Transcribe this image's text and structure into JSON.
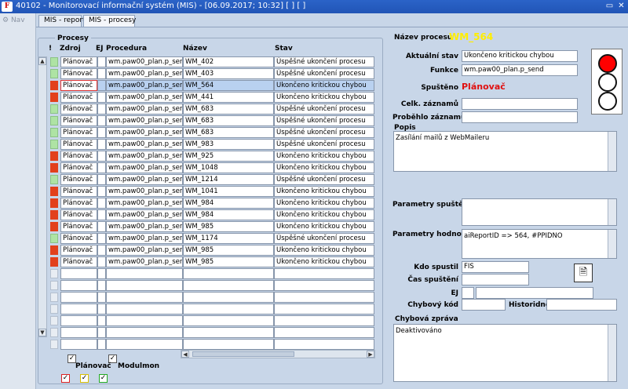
{
  "window": {
    "title": "40102 - Monitorovací informační systém (MIS) - [06.09.2017; 10:32]  [ ]  [ ]"
  },
  "nav": {
    "label": "Nav"
  },
  "tabs": [
    {
      "label": "MIS - reporty"
    },
    {
      "label": "MIS - procesy"
    }
  ],
  "grid": {
    "group_title": "Procesy",
    "headers": {
      "flag": "!",
      "zdroj": "Zdroj",
      "ej": "EJ",
      "procedura": "Procedura",
      "nazev": "Název",
      "stav": "Stav"
    },
    "rows": [
      {
        "status": "green",
        "zdroj": "Plánovač",
        "ej": "",
        "procedura": "wm.paw00_plan.p_send",
        "nazev": "WM_402",
        "stav": "Úspěšné ukončení procesu"
      },
      {
        "status": "green",
        "zdroj": "Plánovač",
        "ej": "",
        "procedura": "wm.paw00_plan.p_send",
        "nazev": "WM_403",
        "stav": "Úspěšné ukončení procesu"
      },
      {
        "status": "red",
        "zdroj": "Plánovač",
        "ej": "",
        "procedura": "wm.paw00_plan.p_send",
        "nazev": "WM_564",
        "stav": "Ukončeno kritickou chybou"
      },
      {
        "status": "red",
        "zdroj": "Plánovač",
        "ej": "",
        "procedura": "wm.paw00_plan.p_send",
        "nazev": "WM_441",
        "stav": "Ukončeno kritickou chybou"
      },
      {
        "status": "green",
        "zdroj": "Plánovač",
        "ej": "",
        "procedura": "wm.paw00_plan.p_send",
        "nazev": "WM_683",
        "stav": "Úspěšné ukončení procesu"
      },
      {
        "status": "green",
        "zdroj": "Plánovač",
        "ej": "",
        "procedura": "wm.paw00_plan.p_send",
        "nazev": "WM_683",
        "stav": "Úspěšné ukončení procesu"
      },
      {
        "status": "green",
        "zdroj": "Plánovač",
        "ej": "",
        "procedura": "wm.paw00_plan.p_send",
        "nazev": "WM_683",
        "stav": "Úspěšné ukončení procesu"
      },
      {
        "status": "green",
        "zdroj": "Plánovač",
        "ej": "",
        "procedura": "wm.paw00_plan.p_send",
        "nazev": "WM_983",
        "stav": "Úspěšné ukončení procesu"
      },
      {
        "status": "red",
        "zdroj": "Plánovač",
        "ej": "",
        "procedura": "wm.paw00_plan.p_send",
        "nazev": "WM_925",
        "stav": "Ukončeno kritickou chybou"
      },
      {
        "status": "red",
        "zdroj": "Plánovač",
        "ej": "",
        "procedura": "wm.paw00_plan.p_send",
        "nazev": "WM_1048",
        "stav": "Ukončeno kritickou chybou"
      },
      {
        "status": "green",
        "zdroj": "Plánovač",
        "ej": "",
        "procedura": "wm.paw00_plan.p_send",
        "nazev": "WM_1214",
        "stav": "Úspěšné ukončení procesu"
      },
      {
        "status": "red",
        "zdroj": "Plánovač",
        "ej": "",
        "procedura": "wm.paw00_plan.p_send",
        "nazev": "WM_1041",
        "stav": "Ukončeno kritickou chybou"
      },
      {
        "status": "red",
        "zdroj": "Plánovač",
        "ej": "",
        "procedura": "wm.paw00_plan.p_send",
        "nazev": "WM_984",
        "stav": "Ukončeno kritickou chybou"
      },
      {
        "status": "red",
        "zdroj": "Plánovač",
        "ej": "",
        "procedura": "wm.paw00_plan.p_send",
        "nazev": "WM_984",
        "stav": "Ukončeno kritickou chybou"
      },
      {
        "status": "red",
        "zdroj": "Plánovač",
        "ej": "",
        "procedura": "wm.paw00_plan.p_send",
        "nazev": "WM_985",
        "stav": "Ukončeno kritickou chybou"
      },
      {
        "status": "green",
        "zdroj": "Plánovač",
        "ej": "",
        "procedura": "wm.paw00_plan.p_send",
        "nazev": "WM_1174",
        "stav": "Úspěšné ukončení procesu"
      },
      {
        "status": "red",
        "zdroj": "Plánovač",
        "ej": "",
        "procedura": "wm.paw00_plan.p_send",
        "nazev": "WM_985",
        "stav": "Ukončeno kritickou chybou"
      },
      {
        "status": "red",
        "zdroj": "Plánovač",
        "ej": "",
        "procedura": "wm.paw00_plan.p_send",
        "nazev": "WM_985",
        "stav": "Ukončeno kritickou chybou"
      },
      {
        "status": "none",
        "zdroj": "",
        "ej": "",
        "procedura": "",
        "nazev": "",
        "stav": ""
      },
      {
        "status": "none",
        "zdroj": "",
        "ej": "",
        "procedura": "",
        "nazev": "",
        "stav": ""
      },
      {
        "status": "none",
        "zdroj": "",
        "ej": "",
        "procedura": "",
        "nazev": "",
        "stav": ""
      },
      {
        "status": "none",
        "zdroj": "",
        "ej": "",
        "procedura": "",
        "nazev": "",
        "stav": ""
      },
      {
        "status": "none",
        "zdroj": "",
        "ej": "",
        "procedura": "",
        "nazev": "",
        "stav": ""
      },
      {
        "status": "none",
        "zdroj": "",
        "ej": "",
        "procedura": "",
        "nazev": "",
        "stav": ""
      },
      {
        "status": "none",
        "zdroj": "",
        "ej": "",
        "procedura": "",
        "nazev": "",
        "stav": ""
      }
    ],
    "selected_row": 2
  },
  "filters": {
    "planovac_label": "Plánovač",
    "modulmon_label": "Modulmon",
    "check_mark": "✓"
  },
  "detail": {
    "nazev_procesu_label": "Název procesu",
    "nazev_procesu_value": "WM_564",
    "aktualni_stav_label": "Aktuální stav",
    "aktualni_stav_value": "Ukončeno kritickou chybou",
    "funkce_label": "Funkce",
    "funkce_value": "wm.paw00_plan.p_send",
    "spusteno_label": "Spuštěno",
    "spusteno_value": "Plánovač",
    "celk_zaznamu_label": "Celk. záznamů",
    "celk_zaznamu_value": "",
    "probehlo_zaznamu_label": "Proběhlo záznamů",
    "probehlo_zaznamu_value": "",
    "popis_label": "Popis",
    "popis_value": "Zasílání mailů z WebMaileru",
    "parametry_spusteni_label": "Parametry spuštění",
    "parametry_spusteni_value": "",
    "parametry_hodnoty_label": "Parametry hodnoty",
    "parametry_hodnoty_value": "aiReportID => 564, #PPIDNO",
    "kdo_spustil_label": "Kdo spustil",
    "kdo_spustil_value": "FIS",
    "cas_spusteni_label": "Čas spuštění",
    "cas_spusteni_value": "",
    "ej_label": "EJ",
    "ej_value": "",
    "ej_name_value": "",
    "chybovy_kod_label": "Chybový kód",
    "chybovy_kod_value": "",
    "historidno_label": "Historidno",
    "historidno_value": "",
    "chybova_zprava_label": "Chybová zpráva",
    "chybova_zprava_value": "Deaktivováno"
  },
  "colors": {
    "accent_title": "#ffee00",
    "spusteno_red": "#e01010",
    "status_red": "#e2401c",
    "status_green": "#aee3a4",
    "selected_row": "#b9d1f0",
    "lamp_red": "#ff0000"
  }
}
